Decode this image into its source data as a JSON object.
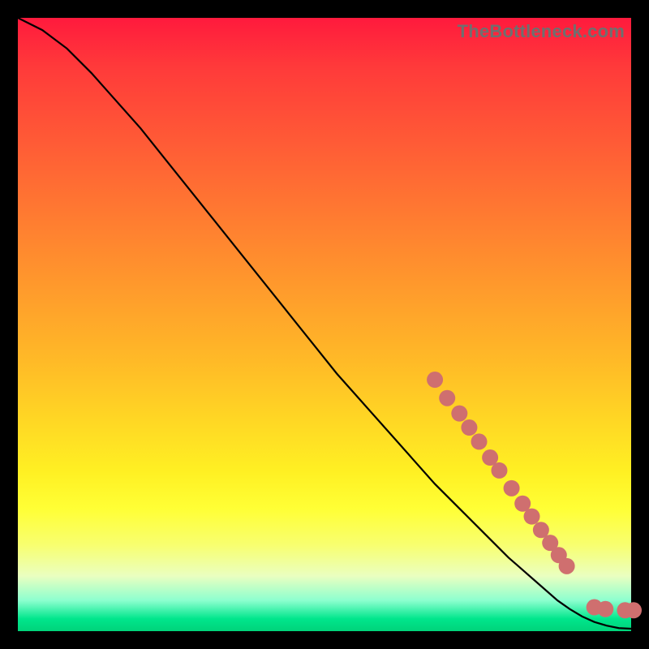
{
  "watermark": "TheBottleneck.com",
  "colors": {
    "curve_stroke": "#000000",
    "marker_fill": "#cf6f6f",
    "marker_stroke": "#cf6f6f"
  },
  "chart_data": {
    "type": "line",
    "title": "",
    "xlabel": "",
    "ylabel": "",
    "xlim": [
      0,
      100
    ],
    "ylim": [
      0,
      100
    ],
    "grid": false,
    "legend": false,
    "series": [
      {
        "name": "bottleneck-curve",
        "x": [
          0,
          4,
          8,
          12,
          16,
          20,
          24,
          28,
          32,
          36,
          40,
          44,
          48,
          52,
          56,
          60,
          64,
          68,
          72,
          76,
          80,
          84,
          88,
          90,
          92,
          94,
          96,
          98,
          100
        ],
        "y": [
          100,
          98,
          95,
          91,
          86.5,
          82,
          77,
          72,
          67,
          62,
          57,
          52,
          47,
          42,
          37.5,
          33,
          28.5,
          24,
          20,
          16,
          12,
          8.5,
          5,
          3.6,
          2.4,
          1.5,
          0.9,
          0.5,
          0.4
        ]
      }
    ],
    "markers": [
      {
        "x": 68,
        "y": 41
      },
      {
        "x": 70,
        "y": 38
      },
      {
        "x": 72,
        "y": 35.5
      },
      {
        "x": 73.6,
        "y": 33.2
      },
      {
        "x": 75.2,
        "y": 30.9
      },
      {
        "x": 77.0,
        "y": 28.3
      },
      {
        "x": 78.5,
        "y": 26.2
      },
      {
        "x": 80.5,
        "y": 23.3
      },
      {
        "x": 82.3,
        "y": 20.8
      },
      {
        "x": 83.8,
        "y": 18.7
      },
      {
        "x": 85.3,
        "y": 16.5
      },
      {
        "x": 86.8,
        "y": 14.4
      },
      {
        "x": 88.2,
        "y": 12.4
      },
      {
        "x": 89.5,
        "y": 10.6
      },
      {
        "x": 94.0,
        "y": 3.9
      },
      {
        "x": 95.8,
        "y": 3.6
      },
      {
        "x": 99.0,
        "y": 3.4
      },
      {
        "x": 100.4,
        "y": 3.4
      }
    ]
  }
}
